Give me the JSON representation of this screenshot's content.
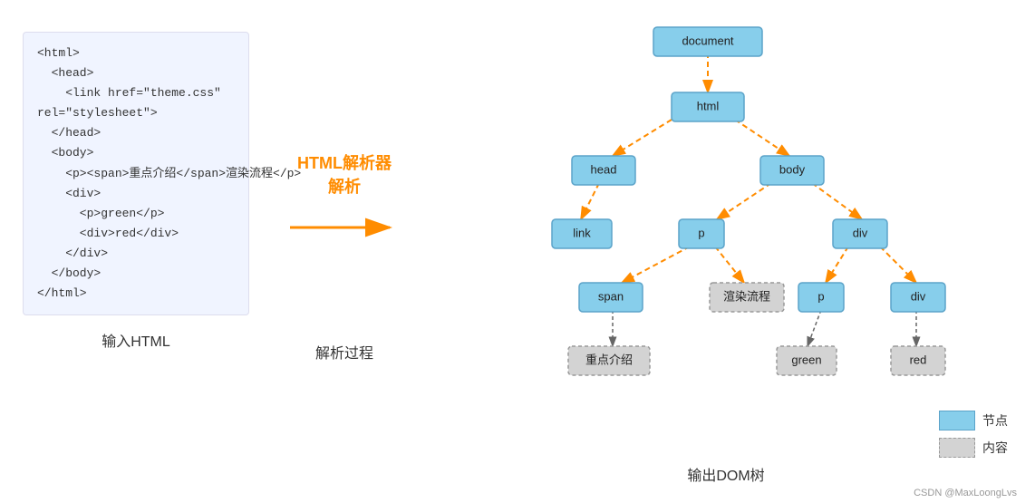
{
  "code": {
    "lines": "<html>\n  <head>\n    <link href=\"theme.css\"\nrel=\"stylesheet\">\n  </head>\n  <body>\n    <p><span>重点介绍</span>渲染流程</p>\n    <div>\n      <p>green</p>\n      <div>red</div>\n    </div>\n  </body>\n</html>",
    "label": "输入HTML"
  },
  "middle": {
    "title": "HTML解析器",
    "subtitle": "解析",
    "label": "解析过程"
  },
  "tree": {
    "label": "输出DOM树",
    "nodes": {
      "document": "document",
      "html": "html",
      "head": "head",
      "body": "body",
      "link": "link",
      "p": "p",
      "div": "div",
      "span": "span",
      "render": "渲染流程",
      "p2": "p",
      "div2": "div",
      "zhongdian": "重点介绍",
      "green": "green",
      "red": "red"
    }
  },
  "legend": {
    "blue_label": "节点",
    "gray_label": "内容"
  },
  "watermark": "CSDN @MaxLoongLvs"
}
